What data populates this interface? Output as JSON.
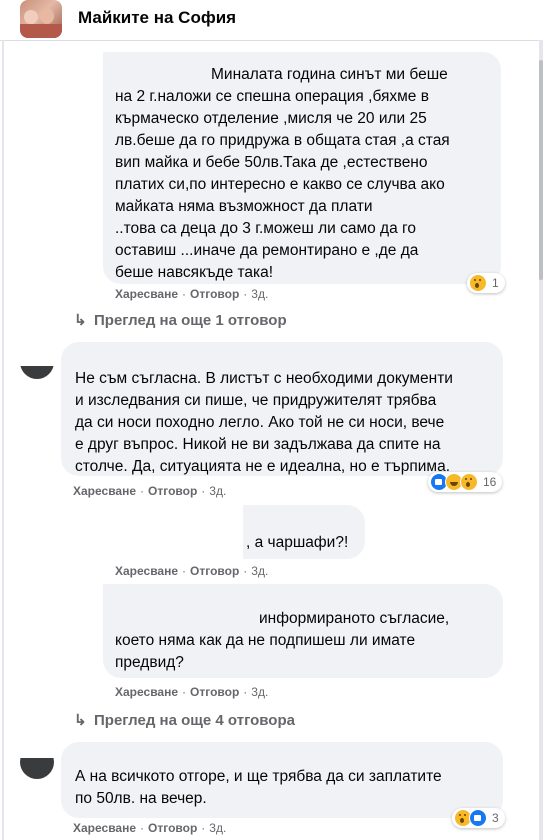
{
  "header": {
    "group_name": "Майките на София"
  },
  "comments": [
    {
      "text_lines": [
        "Миналата година синът ми беше",
        "на 2 г.наложи се спешна операция ,бяхме в",
        "кърмаческо отделение ,мисля че 20 или 25",
        "лв.беше да го придружа в общата стая ,а стая",
        "вип майка и бебе 50лв.Така де ,естествено",
        "платих си,по интересно е какво се случва ако",
        "майката няма възможност да плати",
        "..това са деца до 3 г.можеш ли само да го",
        "оставиш ...иначе да ремонтирано е ,де да",
        "беше навсякъде така!"
      ],
      "like": "Харесване",
      "reply": "Отговор",
      "time": "3д.",
      "reaction_count": "1"
    },
    {
      "text_lines": [
        "Не съм съгласна. В листът с необходими документи",
        "и изследвания си пише, че придружителят трябва",
        "да си носи походно легло. Ако той не си носи, вече",
        "е друг въпрос. Никой не ви задължава да спите на",
        "столче. Да, ситуацията не е идеална, но е търпима."
      ],
      "like": "Харесване",
      "reply": "Отговор",
      "time": "3д.",
      "reaction_count": "16"
    },
    {
      "text_lines": [
        ", а чаршафи?!"
      ],
      "like": "Харесване",
      "reply": "Отговор",
      "time": "3д."
    },
    {
      "text_lines": [
        "информираното съгласие,",
        "което няма как да не подпишеш ли имате",
        "предвид?"
      ],
      "like": "Харесване",
      "reply": "Отговор",
      "time": "3д."
    },
    {
      "text_lines": [
        "А на всичкото отгоре, и ще трябва да си заплатите",
        "по 50лв. на вечер."
      ],
      "like": "Харесване",
      "reply": "Отговор",
      "time": "3д.",
      "reaction_count": "3"
    }
  ],
  "view_more_1": "Преглед на още 1 отговор",
  "view_more_2": "Преглед на още 4 отговора",
  "icons": [
    "reply-arrow-icon",
    "wow-reaction-icon",
    "like-reaction-icon",
    "haha-reaction-icon"
  ]
}
